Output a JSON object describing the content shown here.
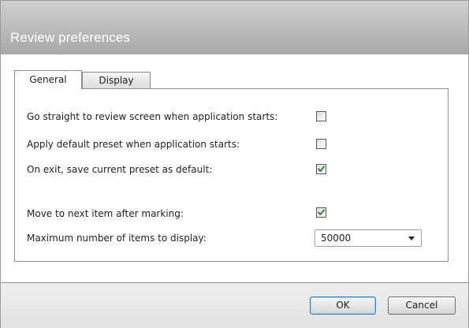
{
  "dialog": {
    "title": "Review preferences"
  },
  "tabs": [
    {
      "label": "General",
      "active": true
    },
    {
      "label": "Display",
      "active": false
    }
  ],
  "options": [
    {
      "label": "Go straight to review screen when application starts:",
      "checked": false
    },
    {
      "label": "Apply default preset when application starts:",
      "checked": false
    },
    {
      "label": "On exit, save current preset as default:",
      "checked": true
    },
    {
      "label": "Move to next item after marking:",
      "checked": true
    }
  ],
  "max_items": {
    "label": "Maximum number of items to display:",
    "selected": "50000"
  },
  "buttons": {
    "ok": "OK",
    "cancel": "Cancel"
  },
  "colors": {
    "title_bar": "#b9b9b9",
    "check_mark": "#2e8b2e",
    "ok_border": "#3c7fb1"
  },
  "icons": {
    "checkmark": "checkmark-icon",
    "dropdown": "chevron-down-icon"
  }
}
